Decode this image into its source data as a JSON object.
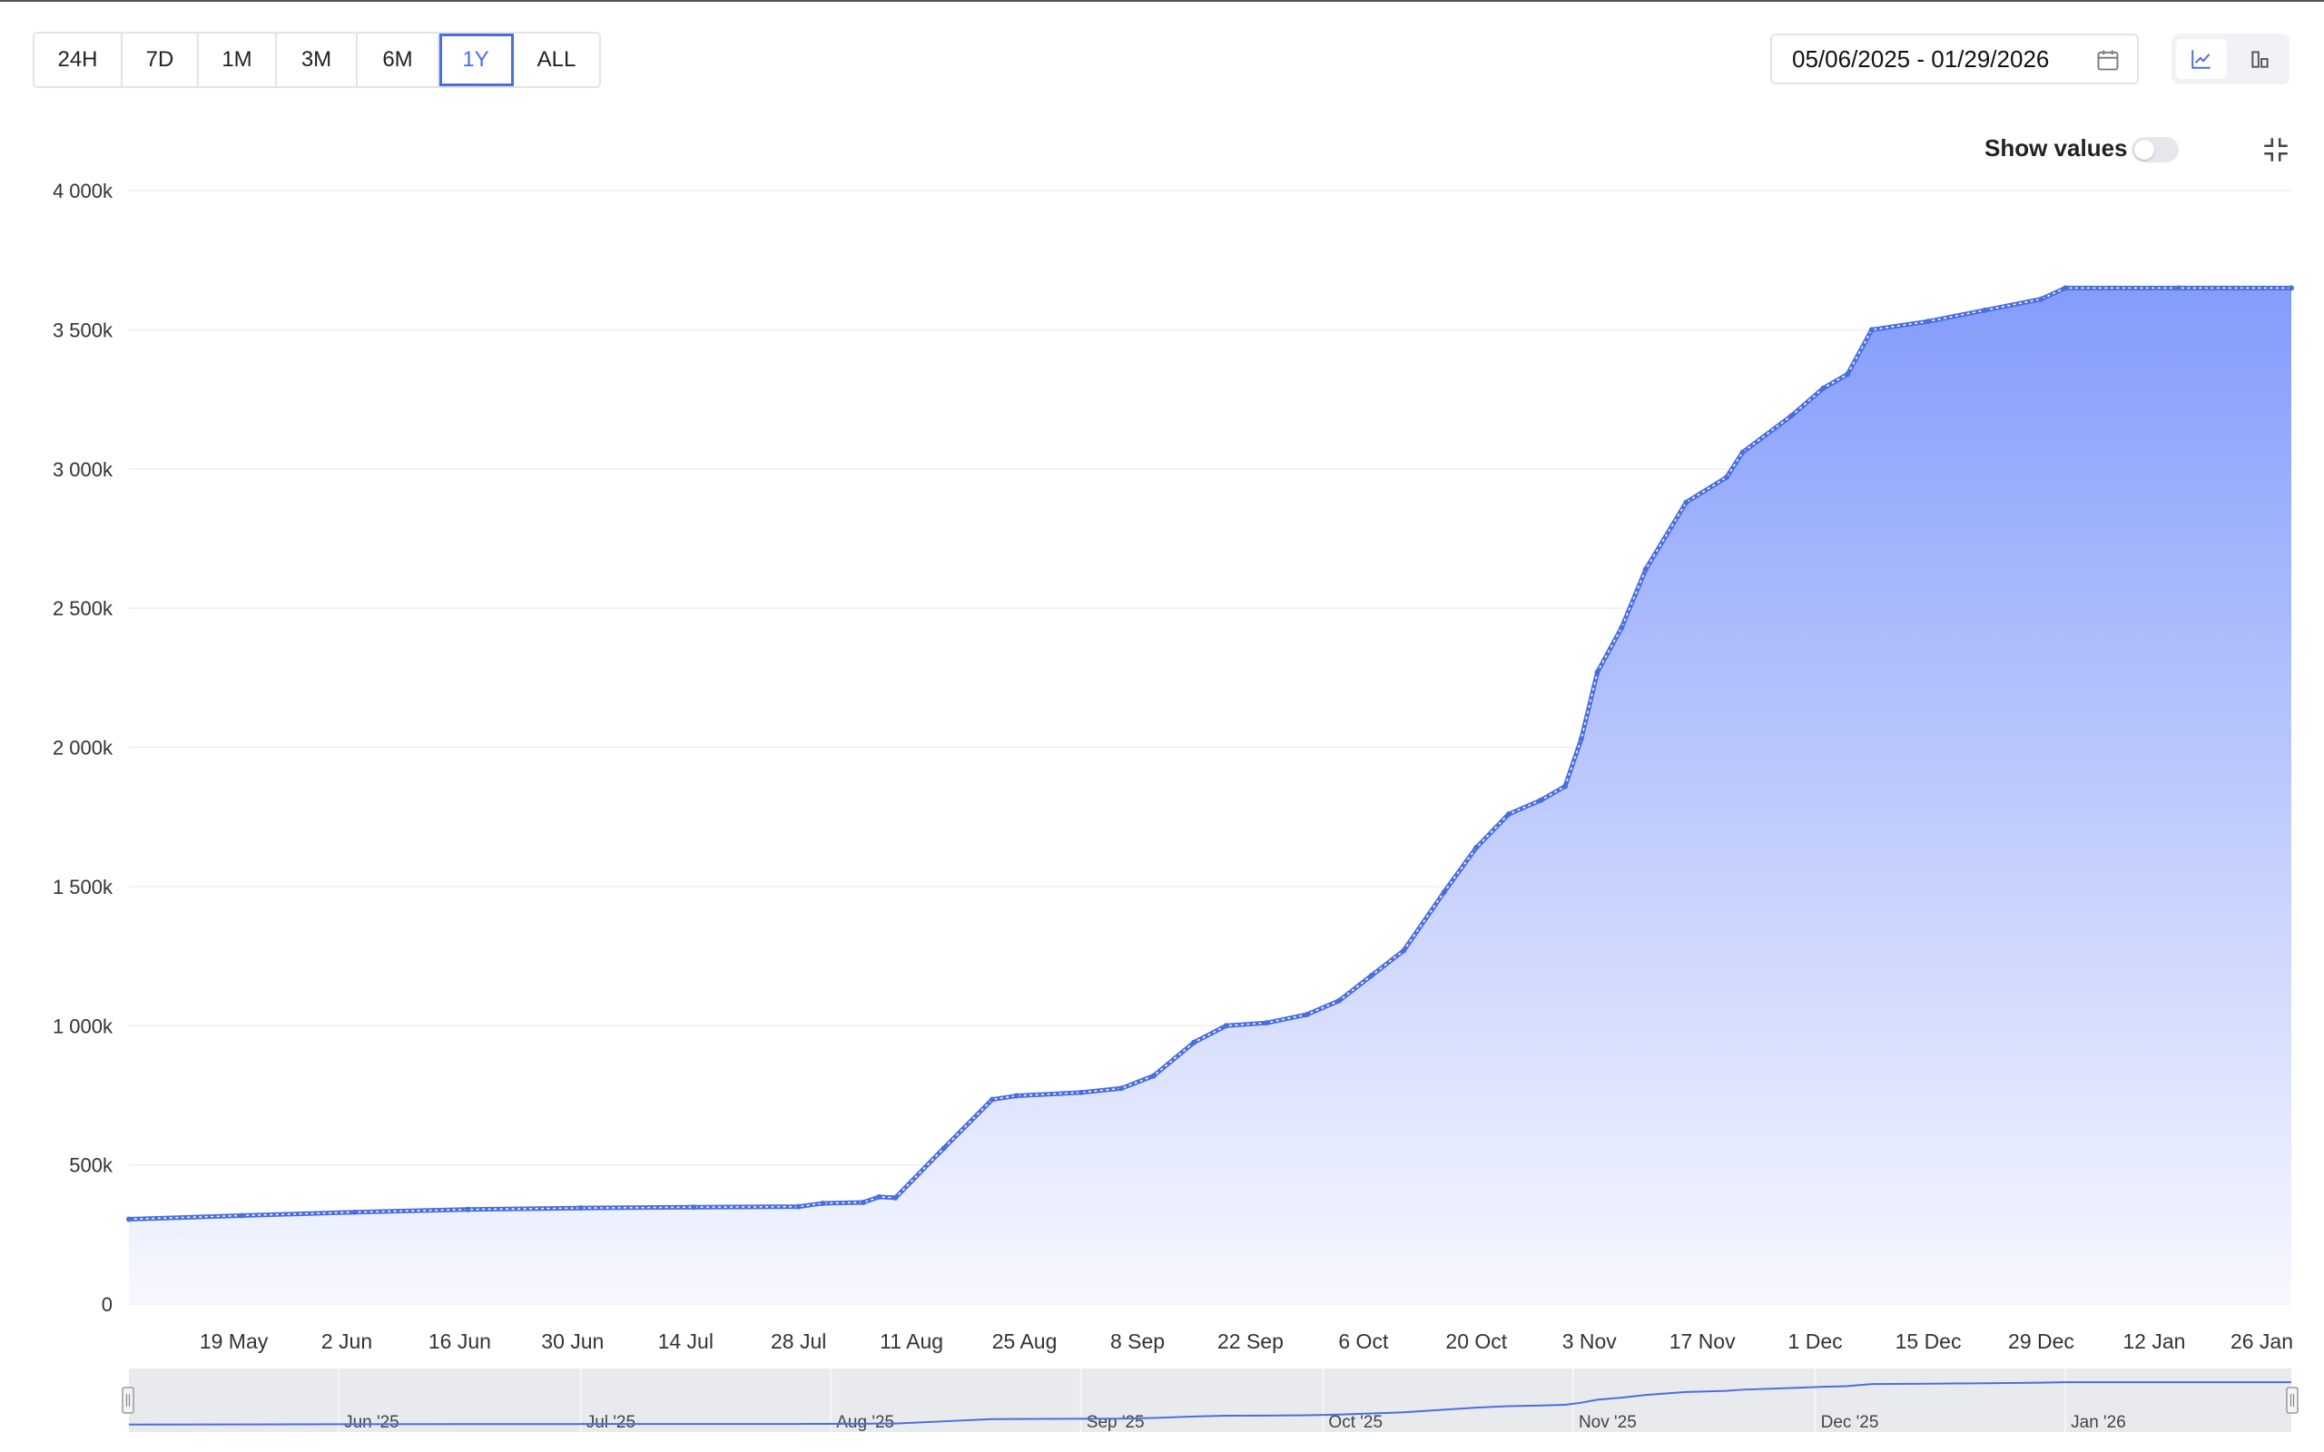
{
  "toolbar": {
    "ranges": [
      "24H",
      "7D",
      "1M",
      "3M",
      "6M",
      "1Y",
      "ALL"
    ],
    "active_range": "1Y",
    "date_range": "05/06/2025 - 01/29/2026",
    "show_values_label": "Show values",
    "show_values_on": false,
    "active_view": "line"
  },
  "colors": {
    "line": "#4a6ee0",
    "area_top": "#849cfb",
    "area_bottom": "#f7f8fe",
    "accent": "#4a6ee0"
  },
  "icons": [
    "calendar-icon",
    "line-chart-icon",
    "bar-chart-icon",
    "collapse-icon",
    "navigator-handle-icon"
  ],
  "chart_data": {
    "type": "area",
    "ylim": [
      0,
      4000000
    ],
    "y_ticks": [
      {
        "value": 0,
        "label": "0"
      },
      {
        "value": 500000,
        "label": "500k"
      },
      {
        "value": 1000000,
        "label": "1 000k"
      },
      {
        "value": 1500000,
        "label": "1 500k"
      },
      {
        "value": 2000000,
        "label": "2 000k"
      },
      {
        "value": 2500000,
        "label": "2 500k"
      },
      {
        "value": 3000000,
        "label": "3 000k"
      },
      {
        "value": 3500000,
        "label": "3 500k"
      },
      {
        "value": 4000000,
        "label": "4 000k"
      }
    ],
    "xlim": [
      "2025-05-06",
      "2026-01-29"
    ],
    "x_ticks": [
      {
        "date": "2025-05-19",
        "label": "19 May"
      },
      {
        "date": "2025-06-02",
        "label": "2 Jun"
      },
      {
        "date": "2025-06-16",
        "label": "16 Jun"
      },
      {
        "date": "2025-06-30",
        "label": "30 Jun"
      },
      {
        "date": "2025-07-14",
        "label": "14 Jul"
      },
      {
        "date": "2025-07-28",
        "label": "28 Jul"
      },
      {
        "date": "2025-08-11",
        "label": "11 Aug"
      },
      {
        "date": "2025-08-25",
        "label": "25 Aug"
      },
      {
        "date": "2025-09-08",
        "label": "8 Sep"
      },
      {
        "date": "2025-09-22",
        "label": "22 Sep"
      },
      {
        "date": "2025-10-06",
        "label": "6 Oct"
      },
      {
        "date": "2025-10-20",
        "label": "20 Oct"
      },
      {
        "date": "2025-11-03",
        "label": "3 Nov"
      },
      {
        "date": "2025-11-17",
        "label": "17 Nov"
      },
      {
        "date": "2025-12-01",
        "label": "1 Dec"
      },
      {
        "date": "2025-12-15",
        "label": "15 Dec"
      },
      {
        "date": "2025-12-29",
        "label": "29 Dec"
      },
      {
        "date": "2026-01-12",
        "label": "12 Jan"
      },
      {
        "date": "2026-01-26",
        "label": "26 Jan"
      }
    ],
    "navigator_ticks": [
      {
        "date": "2025-06-01",
        "label": "Jun '25"
      },
      {
        "date": "2025-07-01",
        "label": "Jul '25"
      },
      {
        "date": "2025-08-01",
        "label": "Aug '25"
      },
      {
        "date": "2025-09-01",
        "label": "Sep '25"
      },
      {
        "date": "2025-10-01",
        "label": "Oct '25"
      },
      {
        "date": "2025-11-01",
        "label": "Nov '25"
      },
      {
        "date": "2025-12-01",
        "label": "Dec '25"
      },
      {
        "date": "2026-01-01",
        "label": "Jan '26"
      }
    ],
    "series": [
      {
        "points": [
          [
            "2025-05-06",
            305000
          ],
          [
            "2025-05-20",
            318000
          ],
          [
            "2025-06-03",
            330000
          ],
          [
            "2025-06-17",
            340000
          ],
          [
            "2025-07-01",
            345000
          ],
          [
            "2025-07-15",
            348000
          ],
          [
            "2025-07-28",
            350000
          ],
          [
            "2025-07-31",
            362000
          ],
          [
            "2025-08-05",
            365000
          ],
          [
            "2025-08-07",
            385000
          ],
          [
            "2025-08-09",
            382000
          ],
          [
            "2025-08-15",
            560000
          ],
          [
            "2025-08-21",
            735000
          ],
          [
            "2025-08-24",
            748000
          ],
          [
            "2025-09-01",
            760000
          ],
          [
            "2025-09-06",
            775000
          ],
          [
            "2025-09-10",
            820000
          ],
          [
            "2025-09-15",
            940000
          ],
          [
            "2025-09-19",
            1000000
          ],
          [
            "2025-09-24",
            1010000
          ],
          [
            "2025-09-29",
            1040000
          ],
          [
            "2025-10-03",
            1090000
          ],
          [
            "2025-10-07",
            1180000
          ],
          [
            "2025-10-11",
            1270000
          ],
          [
            "2025-10-16",
            1480000
          ],
          [
            "2025-10-20",
            1640000
          ],
          [
            "2025-10-24",
            1760000
          ],
          [
            "2025-10-28",
            1810000
          ],
          [
            "2025-10-31",
            1860000
          ],
          [
            "2025-11-02",
            2030000
          ],
          [
            "2025-11-04",
            2270000
          ],
          [
            "2025-11-07",
            2430000
          ],
          [
            "2025-11-10",
            2640000
          ],
          [
            "2025-11-15",
            2880000
          ],
          [
            "2025-11-20",
            2970000
          ],
          [
            "2025-11-22",
            3060000
          ],
          [
            "2025-11-28",
            3190000
          ],
          [
            "2025-12-02",
            3290000
          ],
          [
            "2025-12-05",
            3340000
          ],
          [
            "2025-12-08",
            3500000
          ],
          [
            "2025-12-15",
            3530000
          ],
          [
            "2025-12-22",
            3570000
          ],
          [
            "2025-12-29",
            3610000
          ],
          [
            "2026-01-01",
            3650000
          ],
          [
            "2026-01-15",
            3650000
          ],
          [
            "2026-01-29",
            3650000
          ]
        ]
      }
    ]
  }
}
